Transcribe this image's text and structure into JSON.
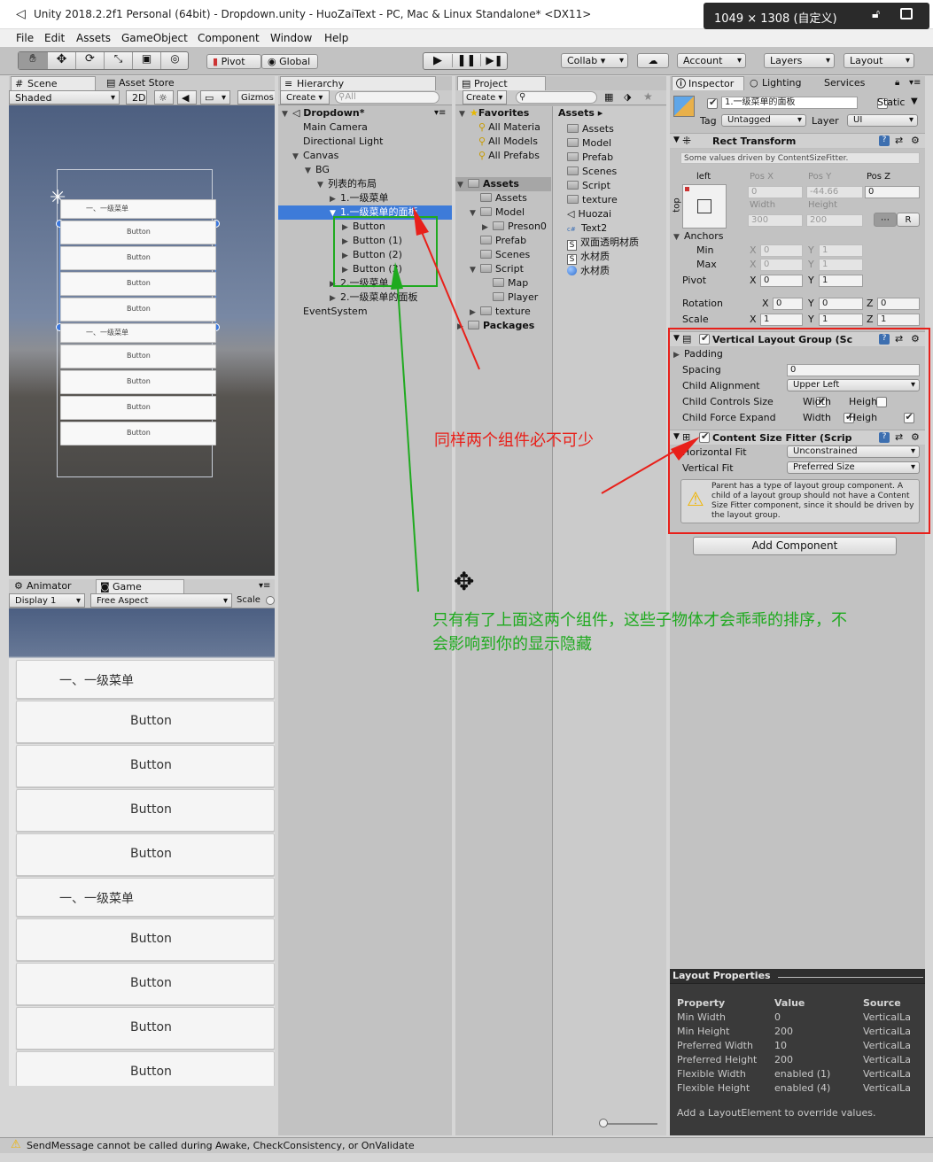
{
  "titlebar": {
    "title": "Unity 2018.2.2f1 Personal (64bit) - Dropdown.unity - HuoZaiText - PC, Mac & Linux Standalone* <DX11>",
    "resolution": "1049 × 1308 (自定义)"
  },
  "menu": [
    "File",
    "Edit",
    "Assets",
    "GameObject",
    "Component",
    "Window",
    "Help"
  ],
  "toolbar": {
    "pivot": "Pivot",
    "global": "Global",
    "collab": "Collab ▾",
    "account": "Account",
    "layers": "Layers",
    "layout": "Layout"
  },
  "scene": {
    "tab_scene": "Scene",
    "tab_store": "Asset Store",
    "shaded": "Shaded",
    "mode_2d": "2D",
    "gizmos": "Gizmos",
    "items": [
      {
        "label": "一、一级菜单",
        "kind": "header"
      },
      {
        "label": "Button",
        "kind": "button"
      },
      {
        "label": "Button",
        "kind": "button"
      },
      {
        "label": "Button",
        "kind": "button"
      },
      {
        "label": "Button",
        "kind": "button"
      },
      {
        "label": "一、一级菜单",
        "kind": "header"
      },
      {
        "label": "Button",
        "kind": "button"
      },
      {
        "label": "Button",
        "kind": "button"
      },
      {
        "label": "Button",
        "kind": "button"
      },
      {
        "label": "Button",
        "kind": "button"
      }
    ]
  },
  "game": {
    "tab_animator": "Animator",
    "tab_game": "Game",
    "display": "Display 1",
    "aspect": "Free Aspect",
    "scale": "Scale",
    "items": [
      {
        "label": "一、一级菜单",
        "kind": "header"
      },
      {
        "label": "Button",
        "kind": "button"
      },
      {
        "label": "Button",
        "kind": "button"
      },
      {
        "label": "Button",
        "kind": "button"
      },
      {
        "label": "Button",
        "kind": "button"
      },
      {
        "label": "一、一级菜单",
        "kind": "header"
      },
      {
        "label": "Button",
        "kind": "button"
      },
      {
        "label": "Button",
        "kind": "button"
      },
      {
        "label": "Button",
        "kind": "button"
      },
      {
        "label": "Button",
        "kind": "button"
      }
    ]
  },
  "hierarchy": {
    "tab": "Hierarchy",
    "create": "Create ▾",
    "search_placeholder": "All",
    "scene_name": "Dropdown*",
    "items": [
      {
        "label": "Main Camera",
        "level": 1
      },
      {
        "label": "Directional Light",
        "level": 1
      },
      {
        "label": "Canvas",
        "level": 1,
        "expanded": true
      },
      {
        "label": "BG",
        "level": 2,
        "expanded": true
      },
      {
        "label": "列表的布局",
        "level": 3,
        "expanded": true
      },
      {
        "label": "1.一级菜单",
        "level": 4
      },
      {
        "label": "1.一级菜单的面板",
        "level": 4,
        "expanded": true,
        "selected": true
      },
      {
        "label": "Button",
        "level": 5
      },
      {
        "label": "Button (1)",
        "level": 5
      },
      {
        "label": "Button (2)",
        "level": 5
      },
      {
        "label": "Button (3)",
        "level": 5
      },
      {
        "label": "2.一级菜单",
        "level": 4
      },
      {
        "label": "2.一级菜单的面板",
        "level": 4
      },
      {
        "label": "EventSystem",
        "level": 1
      }
    ]
  },
  "project": {
    "tab": "Project",
    "create": "Create ▾",
    "favorites_label": "Favorites",
    "favorites": [
      "All Materia",
      "All Models",
      "All Prefabs"
    ],
    "tree": [
      {
        "label": "Assets",
        "level": 0,
        "bold": true
      },
      {
        "label": "Assets",
        "level": 1
      },
      {
        "label": "Model",
        "level": 1
      },
      {
        "label": "Preson0",
        "level": 2
      },
      {
        "label": "Prefab",
        "level": 1
      },
      {
        "label": "Scenes",
        "level": 1
      },
      {
        "label": "Script",
        "level": 1
      },
      {
        "label": "Map",
        "level": 2
      },
      {
        "label": "Player",
        "level": 2
      },
      {
        "label": "texture",
        "level": 1
      },
      {
        "label": "Packages",
        "level": 0,
        "bold": true
      }
    ],
    "assets_header": "Assets ▸",
    "assets": [
      {
        "label": "Assets",
        "icon": "folder"
      },
      {
        "label": "Model",
        "icon": "folder"
      },
      {
        "label": "Prefab",
        "icon": "folder"
      },
      {
        "label": "Scenes",
        "icon": "folder"
      },
      {
        "label": "Script",
        "icon": "folder"
      },
      {
        "label": "texture",
        "icon": "folder"
      },
      {
        "label": "Huozai",
        "icon": "unity"
      },
      {
        "label": "Text2",
        "icon": "cs"
      },
      {
        "label": "双面透明材质",
        "icon": "shader"
      },
      {
        "label": "水材质",
        "icon": "shader"
      },
      {
        "label": "水材质",
        "icon": "sphere"
      }
    ]
  },
  "inspector": {
    "tab_inspector": "Inspector",
    "tab_lighting": "Lighting",
    "tab_services": "Services",
    "object_name": "1.一级菜单的面板",
    "static": "Static",
    "tag_label": "Tag",
    "tag_value": "Untagged",
    "layer_label": "Layer",
    "layer_value": "UI",
    "rect_title": "Rect Transform",
    "rect_note": "Some values driven by ContentSizeFitter.",
    "anchor_left": "left",
    "anchor_top": "top",
    "pos_x_label": "Pos X",
    "pos_y_label": "Pos Y",
    "pos_z_label": "Pos Z",
    "pos_x": "0",
    "pos_y": "-44.66",
    "pos_z": "0",
    "width_label": "Width",
    "height_label": "Height",
    "width": "300",
    "height": "200",
    "r_btn": "R",
    "anchors": "Anchors",
    "min": "Min",
    "max": "Max",
    "pivot": "Pivot",
    "rotation": "Rotation",
    "scale": "Scale",
    "x": "X",
    "y": "Y",
    "z": "Z",
    "min_x": "0",
    "min_y": "1",
    "max_x": "0",
    "max_y": "1",
    "pivot_x": "0",
    "pivot_y": "1",
    "rot_x": "0",
    "rot_y": "0",
    "rot_z": "0",
    "scale_x": "1",
    "scale_y": "1",
    "scale_z": "1",
    "vlg_title": "Vertical Layout Group (Sc",
    "padding": "Padding",
    "spacing_label": "Spacing",
    "spacing": "0",
    "child_alignment_label": "Child Alignment",
    "child_alignment": "Upper Left",
    "child_controls_label": "Child Controls Size",
    "child_force_label": "Child Force Expand",
    "width_chk": "Width",
    "height_chk": "Heigh",
    "csf_title": "Content Size Fitter (Scrip",
    "hfit_label": "Horizontal Fit",
    "hfit": "Unconstrained",
    "vfit_label": "Vertical Fit",
    "vfit": "Preferred Size",
    "warning": "Parent has a type of layout group component. A child of a layout group should not have a Content Size Fitter component, since it should be driven by the layout group.",
    "add_component": "Add Component"
  },
  "layout_props": {
    "title": "Layout Properties",
    "headers": [
      "Property",
      "Value",
      "Source"
    ],
    "rows": [
      [
        "Min Width",
        "0",
        "VerticalLa"
      ],
      [
        "Min Height",
        "200",
        "VerticalLa"
      ],
      [
        "Preferred Width",
        "10",
        "VerticalLa"
      ],
      [
        "Preferred Height",
        "200",
        "VerticalLa"
      ],
      [
        "Flexible Width",
        "enabled (1)",
        "VerticalLa"
      ],
      [
        "Flexible Height",
        "enabled (4)",
        "VerticalLa"
      ]
    ],
    "footer": "Add a LayoutElement to override values."
  },
  "annotations": {
    "red_text": "同样两个组件必不可少",
    "green_text_1": "只有有了上面这两个组件，这些子物体才会乖乖的排序，不",
    "green_text_2": "会影响到你的显示隐藏"
  },
  "statusbar": {
    "message": "SendMessage cannot be called during Awake, CheckConsistency, or OnValidate"
  },
  "colors": {
    "selection": "#3d7bd9",
    "annotation_red": "#e8201a",
    "annotation_green": "#1faa1f",
    "dark_panel": "#3a3a3a"
  }
}
